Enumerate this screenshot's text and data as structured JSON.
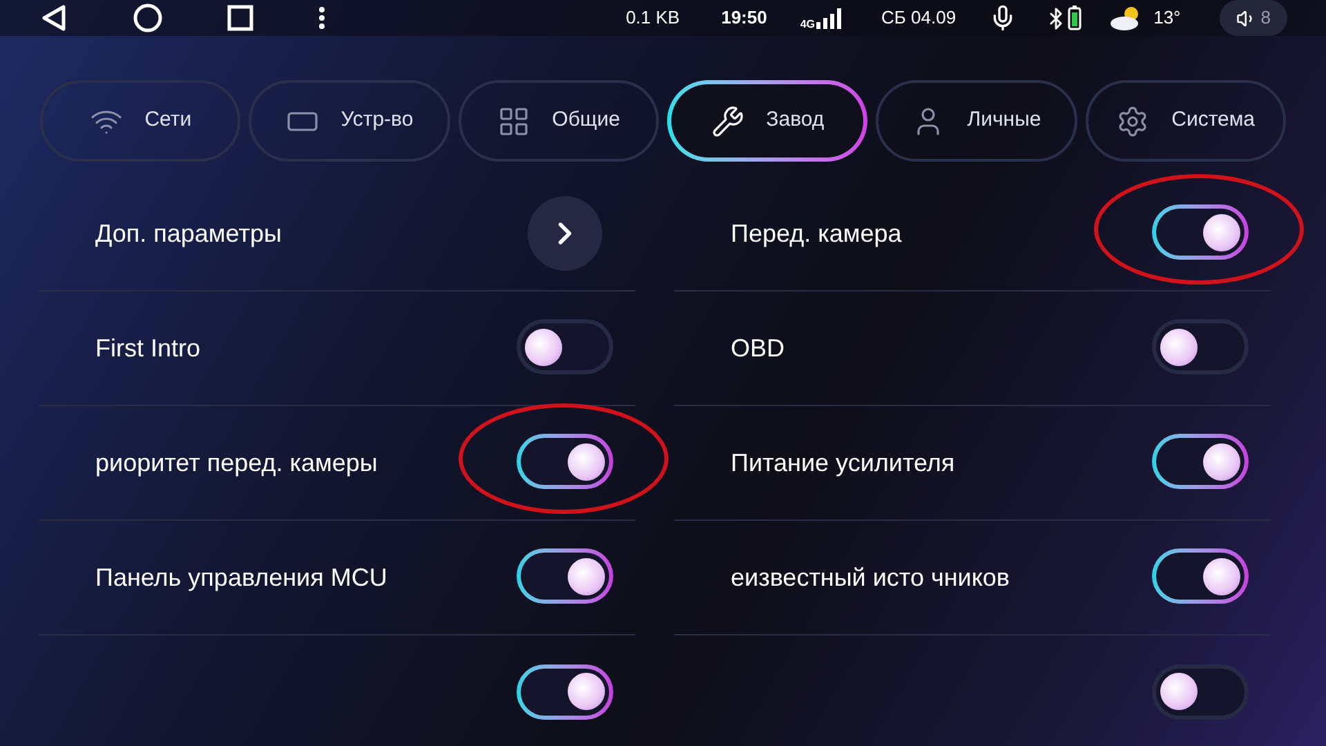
{
  "status_bar": {
    "data_rate": "0.1 KB",
    "time": "19:50",
    "network": "4G",
    "date": "СБ 04.09",
    "temperature": "13°",
    "volume": "8"
  },
  "tabs": [
    {
      "label": "Сети",
      "kind": "network",
      "selected": false
    },
    {
      "label": "Устр-во",
      "kind": "device",
      "selected": false
    },
    {
      "label": "Общие",
      "kind": "general",
      "selected": false
    },
    {
      "label": "Завод",
      "kind": "factory",
      "selected": true
    },
    {
      "label": "Личные",
      "kind": "personal",
      "selected": false
    },
    {
      "label": "Система",
      "kind": "system",
      "selected": false
    }
  ],
  "columns": [
    {
      "rows": [
        {
          "label": "Доп. параметры",
          "kind": "link",
          "highlighted": false
        },
        {
          "label": "First Intro",
          "kind": "toggle",
          "on": false,
          "highlighted": false
        },
        {
          "label": "риоритет перед. камеры",
          "kind": "toggle",
          "on": true,
          "highlighted": true
        },
        {
          "label": "Панель управления MCU",
          "kind": "toggle",
          "on": true,
          "highlighted": false
        },
        {
          "kind": "toggle",
          "on": true,
          "highlighted": false
        }
      ]
    },
    {
      "rows": [
        {
          "label": "Перед. камера",
          "kind": "toggle",
          "on": true,
          "highlighted": true
        },
        {
          "label": "OBD",
          "kind": "toggle",
          "on": false,
          "highlighted": false
        },
        {
          "label": "Питание усилителя",
          "kind": "toggle",
          "on": true,
          "highlighted": false
        },
        {
          "label": "еизвестный исто чников",
          "kind": "toggle",
          "on": true,
          "highlighted": false
        },
        {
          "kind": "toggle",
          "on": false,
          "highlighted": false
        }
      ]
    }
  ]
}
